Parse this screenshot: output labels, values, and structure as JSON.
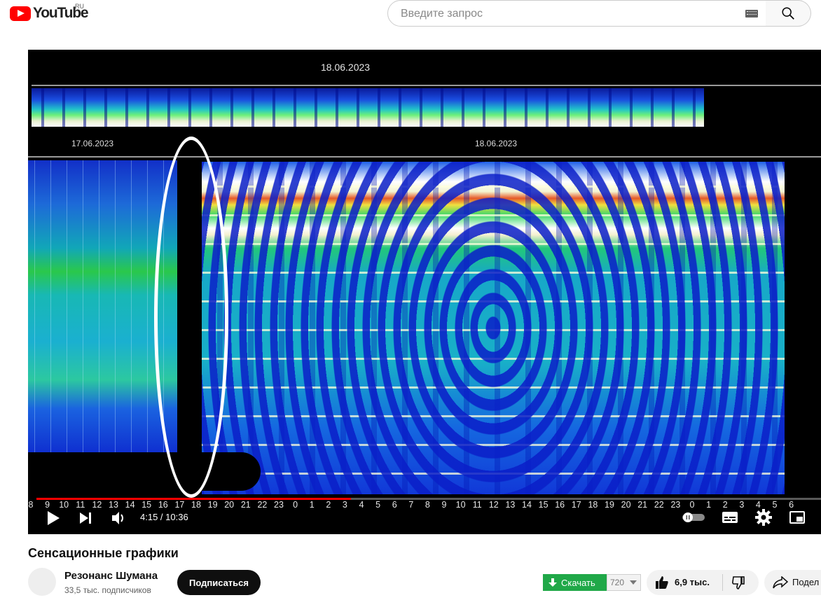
{
  "header": {
    "logo_text": "YouTube",
    "region": "RU",
    "search_placeholder": "Введите запрос"
  },
  "player": {
    "top_date": "18.06.2023",
    "left_date": "17.06.2023",
    "mid_date": "18.06.2023",
    "hour_ticks": [
      "8",
      "9",
      "10",
      "11",
      "12",
      "13",
      "14",
      "15",
      "16",
      "17",
      "18",
      "19",
      "20",
      "21",
      "22",
      "23",
      "0",
      "1",
      "2",
      "3",
      "4",
      "5",
      "6",
      "7",
      "8",
      "9",
      "10",
      "11",
      "12",
      "13",
      "14",
      "15",
      "16",
      "17",
      "18",
      "19",
      "20",
      "21",
      "22",
      "23",
      "0",
      "1",
      "2",
      "3",
      "4",
      "5",
      "6"
    ],
    "current_time": "4:15",
    "duration": "10:36",
    "time_display": "4:15 / 10:36",
    "progress_fraction": 0.401
  },
  "video": {
    "title": "Сенсационные графики",
    "channel_name": "Резонанс Шумана",
    "subscribers": "33,5 тыс. подписчиков",
    "subscribe_label": "Подписаться",
    "download_label": "Скачать",
    "quality": "720",
    "likes": "6,9 тыс.",
    "share_label": "Подел"
  },
  "colors": {
    "brand_red": "#ff0000",
    "download_green": "#20a848",
    "subscribe_black": "#0f0f0f"
  }
}
